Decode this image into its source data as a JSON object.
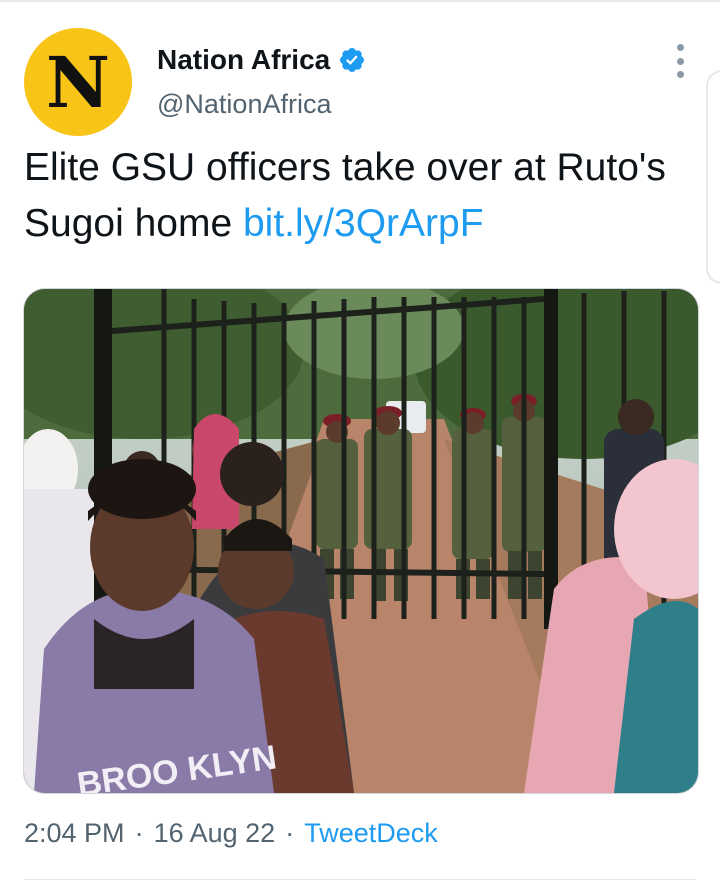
{
  "author": {
    "avatar_letter": "N",
    "display_name": "Nation Africa",
    "handle": "@NationAfrica",
    "verified": true,
    "verified_icon": "verified-badge-icon"
  },
  "tweet": {
    "text": "Elite GSU officers take over at Ruto's Sugoi home ",
    "link": "bit.ly/3QrArpF"
  },
  "meta": {
    "time": "2:04 PM",
    "date": "16 Aug 22",
    "separator": "·",
    "source": "TweetDeck"
  },
  "colors": {
    "avatar_bg": "#f7c417",
    "link": "#1d9bf0",
    "secondary_text": "#536471"
  },
  "icons": {
    "more": "more-vertical-icon"
  }
}
